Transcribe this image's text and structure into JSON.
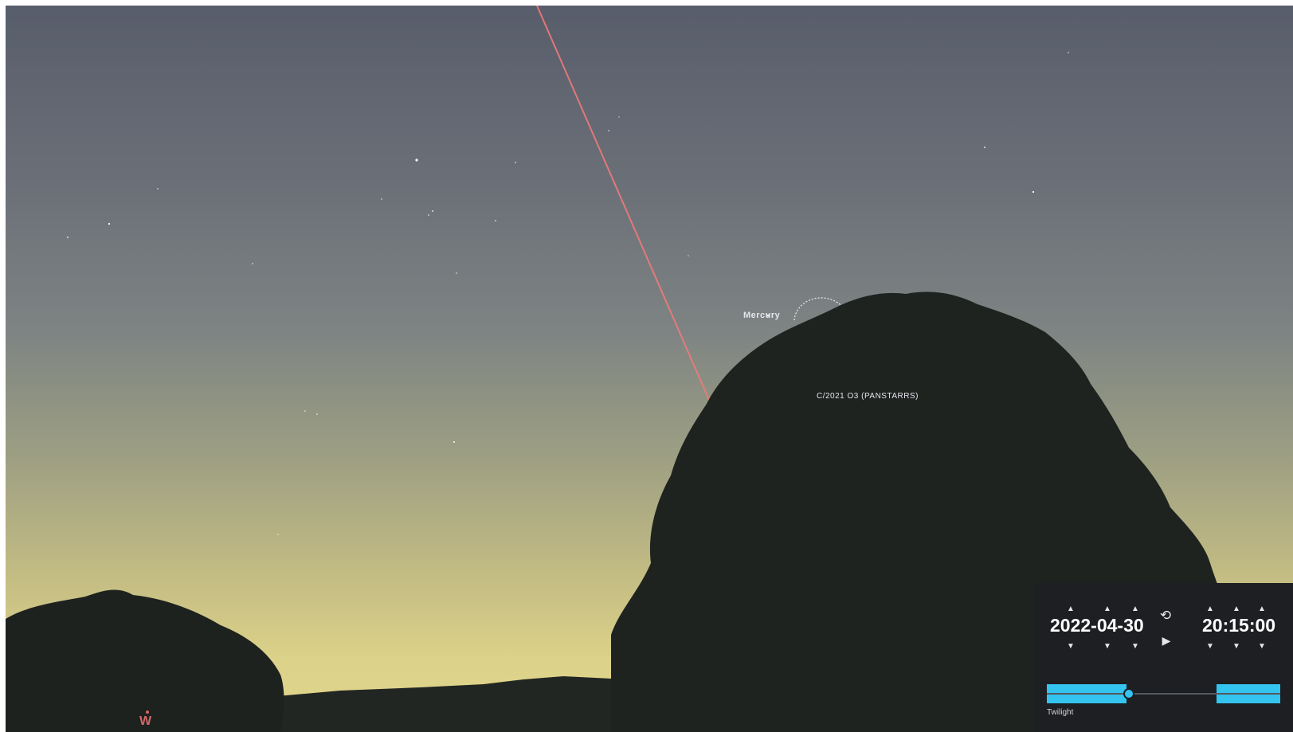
{
  "sky": {
    "objects": [
      {
        "name": "Mercury"
      },
      {
        "name": "C/2021 O3 (PANSTARRS)"
      }
    ],
    "compass_direction": "W"
  },
  "time_panel": {
    "date": "2022-04-30",
    "time": "20:15:00",
    "timeline_label": "Twilight",
    "timeline_position": 0.35,
    "icons": {
      "reset": "history-icon",
      "play": "play-icon",
      "increment": "caret-up-icon",
      "decrement": "caret-down-icon"
    }
  },
  "colors": {
    "timeline_accent": "#33c4ef",
    "panel_background": "#1e1f23",
    "meteor_line": "#f07a7a",
    "compass": "#d06a6a"
  }
}
